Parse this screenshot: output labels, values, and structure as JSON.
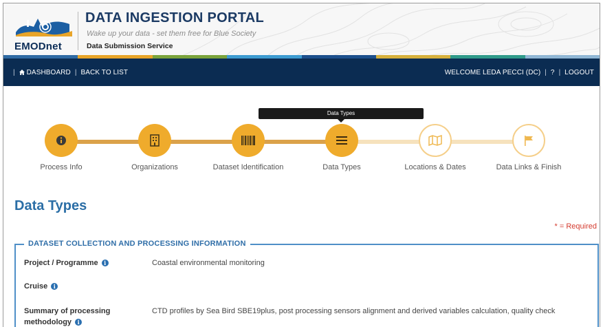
{
  "header": {
    "logo_text": "EMODnet",
    "title": "DATA INGESTION PORTAL",
    "subtitle": "Wake up your data - set them free for Blue Society",
    "service": "Data Submission Service",
    "colors": [
      "#2f6aa3",
      "#e8a428",
      "#7aa33b",
      "#3d9bd1",
      "#1c4f8c",
      "#d6b03c",
      "#2f9a8a",
      "#8fb6d4"
    ]
  },
  "nav": {
    "dashboard": "DASHBOARD",
    "back_to_list": "BACK TO LIST",
    "welcome": "WELCOME LEDA PECCI (DC)",
    "help": "?",
    "logout": "LOGOUT",
    "pipe": "|",
    "bg_color": "#0b2c52"
  },
  "stepper": {
    "tooltip": "Data Types",
    "steps": [
      {
        "label": "Process Info",
        "icon": "info-icon",
        "state": "done"
      },
      {
        "label": "Organizations",
        "icon": "building-icon",
        "state": "done"
      },
      {
        "label": "Dataset Identification",
        "icon": "barcode-icon",
        "state": "done"
      },
      {
        "label": "Data Types",
        "icon": "list-icon",
        "state": "current"
      },
      {
        "label": "Locations & Dates",
        "icon": "map-icon",
        "state": "todo"
      },
      {
        "label": "Data Links & Finish",
        "icon": "flag-icon",
        "state": "todo"
      }
    ],
    "accent_color": "#efab2c"
  },
  "content": {
    "page_title": "Data Types",
    "required_note": "* = Required",
    "section_legend": "DATASET COLLECTION AND PROCESSING INFORMATION",
    "fields": [
      {
        "label": "Project / Programme",
        "value": "Coastal environmental monitoring"
      },
      {
        "label": "Cruise",
        "value": ""
      },
      {
        "label_line1": "Summary of processing",
        "label_line2": "methodology",
        "value": "CTD profiles by Sea Bird SBE19plus, post processing sensors alignment and derived variables calculation, quality check"
      }
    ]
  }
}
